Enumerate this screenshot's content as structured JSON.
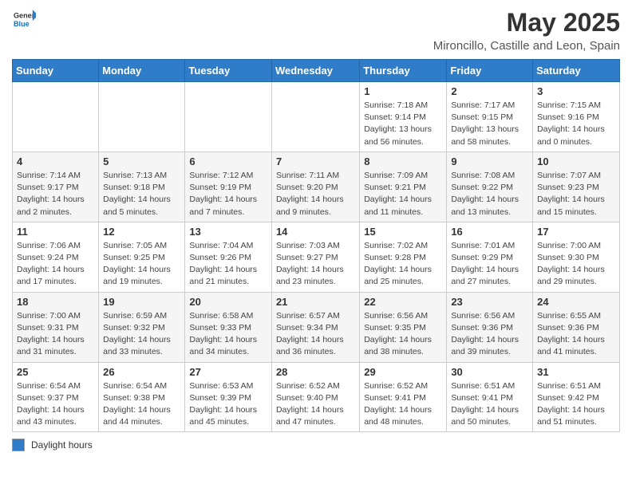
{
  "header": {
    "logo_general": "General",
    "logo_blue": "Blue",
    "month_title": "May 2025",
    "subtitle": "Mironcillo, Castille and Leon, Spain"
  },
  "days_of_week": [
    "Sunday",
    "Monday",
    "Tuesday",
    "Wednesday",
    "Thursday",
    "Friday",
    "Saturday"
  ],
  "weeks": [
    [
      {
        "day": "",
        "info": ""
      },
      {
        "day": "",
        "info": ""
      },
      {
        "day": "",
        "info": ""
      },
      {
        "day": "",
        "info": ""
      },
      {
        "day": "1",
        "info": "Sunrise: 7:18 AM\nSunset: 9:14 PM\nDaylight: 13 hours\nand 56 minutes."
      },
      {
        "day": "2",
        "info": "Sunrise: 7:17 AM\nSunset: 9:15 PM\nDaylight: 13 hours\nand 58 minutes."
      },
      {
        "day": "3",
        "info": "Sunrise: 7:15 AM\nSunset: 9:16 PM\nDaylight: 14 hours\nand 0 minutes."
      }
    ],
    [
      {
        "day": "4",
        "info": "Sunrise: 7:14 AM\nSunset: 9:17 PM\nDaylight: 14 hours\nand 2 minutes."
      },
      {
        "day": "5",
        "info": "Sunrise: 7:13 AM\nSunset: 9:18 PM\nDaylight: 14 hours\nand 5 minutes."
      },
      {
        "day": "6",
        "info": "Sunrise: 7:12 AM\nSunset: 9:19 PM\nDaylight: 14 hours\nand 7 minutes."
      },
      {
        "day": "7",
        "info": "Sunrise: 7:11 AM\nSunset: 9:20 PM\nDaylight: 14 hours\nand 9 minutes."
      },
      {
        "day": "8",
        "info": "Sunrise: 7:09 AM\nSunset: 9:21 PM\nDaylight: 14 hours\nand 11 minutes."
      },
      {
        "day": "9",
        "info": "Sunrise: 7:08 AM\nSunset: 9:22 PM\nDaylight: 14 hours\nand 13 minutes."
      },
      {
        "day": "10",
        "info": "Sunrise: 7:07 AM\nSunset: 9:23 PM\nDaylight: 14 hours\nand 15 minutes."
      }
    ],
    [
      {
        "day": "11",
        "info": "Sunrise: 7:06 AM\nSunset: 9:24 PM\nDaylight: 14 hours\nand 17 minutes."
      },
      {
        "day": "12",
        "info": "Sunrise: 7:05 AM\nSunset: 9:25 PM\nDaylight: 14 hours\nand 19 minutes."
      },
      {
        "day": "13",
        "info": "Sunrise: 7:04 AM\nSunset: 9:26 PM\nDaylight: 14 hours\nand 21 minutes."
      },
      {
        "day": "14",
        "info": "Sunrise: 7:03 AM\nSunset: 9:27 PM\nDaylight: 14 hours\nand 23 minutes."
      },
      {
        "day": "15",
        "info": "Sunrise: 7:02 AM\nSunset: 9:28 PM\nDaylight: 14 hours\nand 25 minutes."
      },
      {
        "day": "16",
        "info": "Sunrise: 7:01 AM\nSunset: 9:29 PM\nDaylight: 14 hours\nand 27 minutes."
      },
      {
        "day": "17",
        "info": "Sunrise: 7:00 AM\nSunset: 9:30 PM\nDaylight: 14 hours\nand 29 minutes."
      }
    ],
    [
      {
        "day": "18",
        "info": "Sunrise: 7:00 AM\nSunset: 9:31 PM\nDaylight: 14 hours\nand 31 minutes."
      },
      {
        "day": "19",
        "info": "Sunrise: 6:59 AM\nSunset: 9:32 PM\nDaylight: 14 hours\nand 33 minutes."
      },
      {
        "day": "20",
        "info": "Sunrise: 6:58 AM\nSunset: 9:33 PM\nDaylight: 14 hours\nand 34 minutes."
      },
      {
        "day": "21",
        "info": "Sunrise: 6:57 AM\nSunset: 9:34 PM\nDaylight: 14 hours\nand 36 minutes."
      },
      {
        "day": "22",
        "info": "Sunrise: 6:56 AM\nSunset: 9:35 PM\nDaylight: 14 hours\nand 38 minutes."
      },
      {
        "day": "23",
        "info": "Sunrise: 6:56 AM\nSunset: 9:36 PM\nDaylight: 14 hours\nand 39 minutes."
      },
      {
        "day": "24",
        "info": "Sunrise: 6:55 AM\nSunset: 9:36 PM\nDaylight: 14 hours\nand 41 minutes."
      }
    ],
    [
      {
        "day": "25",
        "info": "Sunrise: 6:54 AM\nSunset: 9:37 PM\nDaylight: 14 hours\nand 43 minutes."
      },
      {
        "day": "26",
        "info": "Sunrise: 6:54 AM\nSunset: 9:38 PM\nDaylight: 14 hours\nand 44 minutes."
      },
      {
        "day": "27",
        "info": "Sunrise: 6:53 AM\nSunset: 9:39 PM\nDaylight: 14 hours\nand 45 minutes."
      },
      {
        "day": "28",
        "info": "Sunrise: 6:52 AM\nSunset: 9:40 PM\nDaylight: 14 hours\nand 47 minutes."
      },
      {
        "day": "29",
        "info": "Sunrise: 6:52 AM\nSunset: 9:41 PM\nDaylight: 14 hours\nand 48 minutes."
      },
      {
        "day": "30",
        "info": "Sunrise: 6:51 AM\nSunset: 9:41 PM\nDaylight: 14 hours\nand 50 minutes."
      },
      {
        "day": "31",
        "info": "Sunrise: 6:51 AM\nSunset: 9:42 PM\nDaylight: 14 hours\nand 51 minutes."
      }
    ]
  ],
  "footer": {
    "legend_label": "Daylight hours"
  }
}
